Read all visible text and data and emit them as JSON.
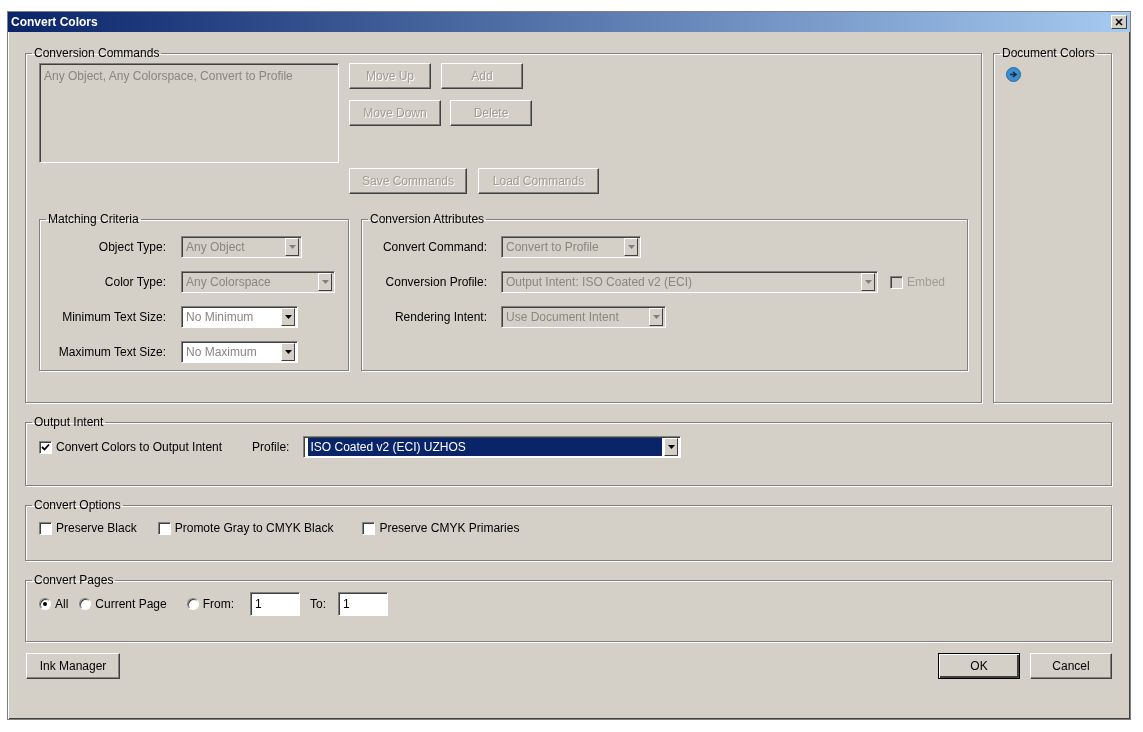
{
  "window": {
    "title": "Convert Colors"
  },
  "conversion_commands": {
    "title": "Conversion Commands",
    "items": [
      {
        "text": "Any Object, Any Colorspace, Convert to Profile",
        "selected": false
      }
    ],
    "buttons": [
      {
        "label": "Move Up",
        "disabled": true
      },
      {
        "label": "Add",
        "disabled": true
      },
      {
        "label": "Move Down",
        "disabled": true
      },
      {
        "label": "Delete",
        "disabled": true
      },
      {
        "label": "Save Commands",
        "disabled": true
      },
      {
        "label": "Load Commands",
        "disabled": true
      }
    ]
  },
  "matching_criteria": {
    "title": "Matching Criteria",
    "fields": [
      {
        "label": "Object Type:",
        "value": "Any Object",
        "disabled": true
      },
      {
        "label": "Color Type:",
        "value": "Any Colorspace",
        "disabled": true
      },
      {
        "label": "Minimum Text Size:",
        "value": "No Minimum",
        "disabled": false
      },
      {
        "label": "Maximum Text Size:",
        "value": "No Maximum",
        "disabled": false
      }
    ]
  },
  "conversion_attributes": {
    "title": "Conversion Attributes",
    "fields": [
      {
        "label": "Convert Command:",
        "value": "Convert to Profile",
        "disabled": true
      },
      {
        "label": "Conversion Profile:",
        "value": "Output Intent: ISO Coated v2 (ECI)",
        "disabled": true
      },
      {
        "label": "Rendering Intent:",
        "value": "Use Document Intent",
        "disabled": true
      }
    ],
    "embed": {
      "label": "Embed",
      "checked": false,
      "disabled": true
    }
  },
  "document_colors": {
    "title": "Document Colors"
  },
  "output_intent": {
    "title": "Output Intent",
    "checkbox": {
      "label": "Convert Colors to Output Intent",
      "checked": true
    },
    "profile_label": "Profile:",
    "profile": {
      "value": "ISO Coated v2 (ECI) UZHOS",
      "focused": true
    }
  },
  "convert_options": {
    "title": "Convert Options",
    "options": [
      {
        "label": "Preserve Black",
        "checked": false
      },
      {
        "label": "Promote Gray to CMYK Black",
        "checked": false
      },
      {
        "label": "Preserve CMYK Primaries",
        "checked": false
      }
    ]
  },
  "convert_pages": {
    "title": "Convert Pages",
    "options": [
      {
        "label": "All",
        "selected": true
      },
      {
        "label": "Current Page",
        "selected": false
      },
      {
        "label": "From:",
        "selected": false
      }
    ],
    "from_value": "1",
    "to_label": "To:",
    "to_value": "1"
  },
  "footer": {
    "left_button": {
      "label": "Ink Manager"
    },
    "buttons": [
      {
        "label": "OK",
        "default": true
      },
      {
        "label": "Cancel",
        "default": false
      }
    ]
  }
}
